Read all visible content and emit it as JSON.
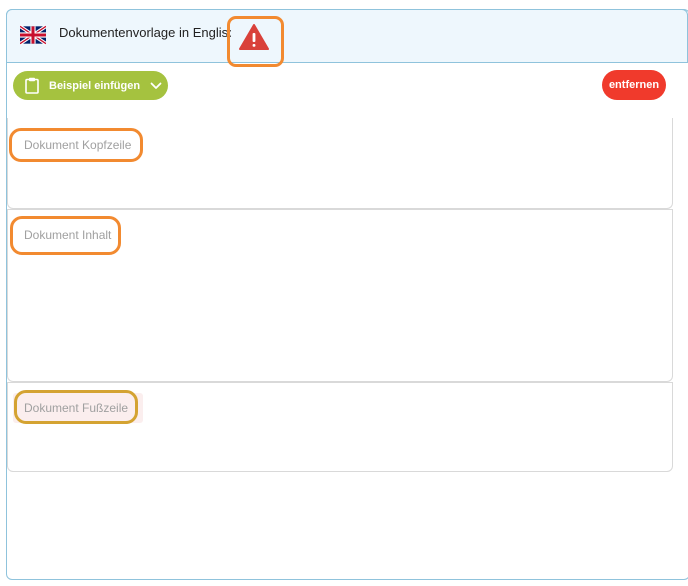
{
  "header": {
    "title": "Dokumentenvorlage in Englisch",
    "flag_icon": "uk-flag-icon",
    "warning_icon": "warning-triangle-icon"
  },
  "toolbar": {
    "insert_label": "Beispiel einfügen",
    "remove_label": "entfernen"
  },
  "sections": {
    "header_placeholder": "Dokument Kopfzeile",
    "body_placeholder": "Dokument Inhalt",
    "footer_placeholder": "Dokument Fußzeile"
  },
  "colors": {
    "insert_button": "#a5c23f",
    "remove_button": "#f03a2c",
    "warning": "#d9413a",
    "highlight": "#f28a30",
    "panel_border": "#8fc3dc",
    "header_bg": "#eef7fd"
  }
}
